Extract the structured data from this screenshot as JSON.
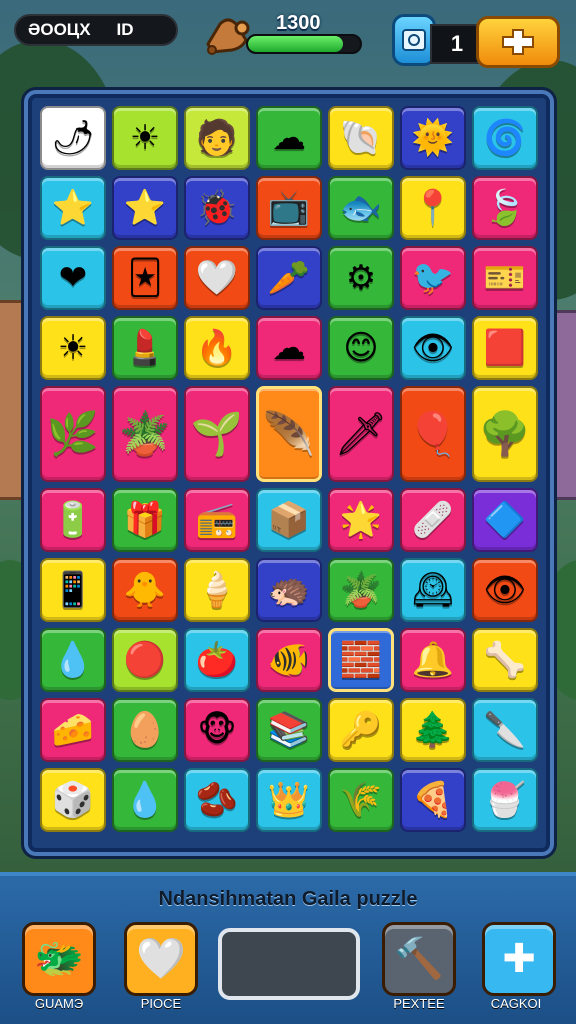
{
  "hud": {
    "score_label": "ƏOOЦX",
    "score_value": "ID",
    "target_score": "1300",
    "progress_fraction": 0.85,
    "lives": "1"
  },
  "board": {
    "rows": [
      [
        {
          "name": "red-leaf",
          "glyph": "🌶",
          "bg": "#ffffff"
        },
        {
          "name": "sun",
          "glyph": "☀",
          "bg": "#a6e22e"
        },
        {
          "name": "hat-person",
          "glyph": "🧑",
          "bg": "#c6e83a"
        },
        {
          "name": "cloud-face",
          "glyph": "☁",
          "bg": "#35b83a"
        },
        {
          "name": "fan-shell",
          "glyph": "🐚",
          "bg": "#ffe11a"
        },
        {
          "name": "sun-face",
          "glyph": "🌞",
          "bg": "#3340c8"
        },
        {
          "name": "swirl",
          "glyph": "🌀",
          "bg": "#2bc4e8"
        }
      ],
      [
        {
          "name": "star-map",
          "glyph": "⭐",
          "bg": "#2bc4e8"
        },
        {
          "name": "star-face",
          "glyph": "⭐",
          "bg": "#3340c8"
        },
        {
          "name": "purple-bug",
          "glyph": "🐞",
          "bg": "#3340c8"
        },
        {
          "name": "tv-screen",
          "glyph": "📺",
          "bg": "#f24a14"
        },
        {
          "name": "gray-fish",
          "glyph": "🐟",
          "bg": "#35b83a"
        },
        {
          "name": "pin",
          "glyph": "📍",
          "bg": "#ffe11a"
        },
        {
          "name": "red-leaf-2",
          "glyph": "🍃",
          "bg": "#f02878"
        }
      ],
      [
        {
          "name": "heart",
          "glyph": "❤",
          "bg": "#2bc4e8"
        },
        {
          "name": "card",
          "glyph": "🃏",
          "bg": "#f24a14"
        },
        {
          "name": "white-heart",
          "glyph": "🤍",
          "bg": "#f24a14"
        },
        {
          "name": "carrot",
          "glyph": "🥕",
          "bg": "#3340c8"
        },
        {
          "name": "gear-sun",
          "glyph": "⚙",
          "bg": "#35b83a"
        },
        {
          "name": "green-bird",
          "glyph": "🐦",
          "bg": "#f02878"
        },
        {
          "name": "ticket",
          "glyph": "🎫",
          "bg": "#f02878"
        }
      ],
      [
        {
          "name": "sun-2",
          "glyph": "☀",
          "bg": "#ffe11a"
        },
        {
          "name": "lipstick",
          "glyph": "💄",
          "bg": "#35b83a"
        },
        {
          "name": "flame",
          "glyph": "🔥",
          "bg": "#ffe11a"
        },
        {
          "name": "cyan-cloud",
          "glyph": "☁",
          "bg": "#f02878"
        },
        {
          "name": "smiley",
          "glyph": "😊",
          "bg": "#35b83a"
        },
        {
          "name": "eye",
          "glyph": "👁",
          "bg": "#2bc4e8"
        },
        {
          "name": "red-box",
          "glyph": "🟥",
          "bg": "#ffe11a"
        }
      ],
      [
        {
          "name": "plant",
          "glyph": "🌿",
          "bg": "#f02878",
          "tall": true
        },
        {
          "name": "potted-plant",
          "glyph": "🪴",
          "bg": "#f02878",
          "tall": true
        },
        {
          "name": "branch",
          "glyph": "🌱",
          "bg": "#f02878",
          "tall": true
        },
        {
          "name": "feather",
          "glyph": "🪶",
          "bg": "#ff8a1a",
          "tall": true,
          "sel": true
        },
        {
          "name": "sword",
          "glyph": "🗡",
          "bg": "#f02878",
          "tall": true
        },
        {
          "name": "balloon",
          "glyph": "🎈",
          "bg": "#f24a14",
          "tall": true
        },
        {
          "name": "tree",
          "glyph": "🌳",
          "bg": "#ffe11a",
          "tall": true
        }
      ],
      [
        {
          "name": "battery",
          "glyph": "🔋",
          "bg": "#f02878"
        },
        {
          "name": "chest",
          "glyph": "🎁",
          "bg": "#35b83a"
        },
        {
          "name": "radio",
          "glyph": "📻",
          "bg": "#f02878"
        },
        {
          "name": "box",
          "glyph": "📦",
          "bg": "#2bc4e8"
        },
        {
          "name": "sun-burst",
          "glyph": "🌟",
          "bg": "#f02878"
        },
        {
          "name": "bandage",
          "glyph": "🩹",
          "bg": "#f02878"
        },
        {
          "name": "dots-box",
          "glyph": "🔷",
          "bg": "#7a2ed8"
        }
      ],
      [
        {
          "name": "phone",
          "glyph": "📱",
          "bg": "#ffe11a"
        },
        {
          "name": "chick",
          "glyph": "🐥",
          "bg": "#f24a14"
        },
        {
          "name": "cream",
          "glyph": "🍦",
          "bg": "#ffe11a"
        },
        {
          "name": "spiky-ball",
          "glyph": "🦔",
          "bg": "#3340c8"
        },
        {
          "name": "bowl-plant",
          "glyph": "🪴",
          "bg": "#35b83a"
        },
        {
          "name": "clock-face",
          "glyph": "🕰",
          "bg": "#2bc4e8"
        },
        {
          "name": "spiky-eye",
          "glyph": "👁",
          "bg": "#f24a14"
        }
      ],
      [
        {
          "name": "drop-face",
          "glyph": "💧",
          "bg": "#35b83a"
        },
        {
          "name": "red-drop",
          "glyph": "🔴",
          "bg": "#a6e22e"
        },
        {
          "name": "tomato",
          "glyph": "🍅",
          "bg": "#2bc4e8"
        },
        {
          "name": "fish",
          "glyph": "🐠",
          "bg": "#f02878"
        },
        {
          "name": "crate",
          "glyph": "🧱",
          "bg": "#2f6ad8",
          "sel": true
        },
        {
          "name": "bell-face",
          "glyph": "🔔",
          "bg": "#f02878"
        },
        {
          "name": "bone",
          "glyph": "🦴",
          "bg": "#ffe11a"
        }
      ],
      [
        {
          "name": "cheese",
          "glyph": "🧀",
          "bg": "#f02878"
        },
        {
          "name": "egg",
          "glyph": "🥚",
          "bg": "#35b83a"
        },
        {
          "name": "monkey",
          "glyph": "🐵",
          "bg": "#f02878"
        },
        {
          "name": "books",
          "glyph": "📚",
          "bg": "#35b83a"
        },
        {
          "name": "key",
          "glyph": "🔑",
          "bg": "#ffe11a"
        },
        {
          "name": "bush",
          "glyph": "🌲",
          "bg": "#ffe11a"
        },
        {
          "name": "knife",
          "glyph": "🔪",
          "bg": "#2bc4e8"
        }
      ],
      [
        {
          "name": "dice",
          "glyph": "🎲",
          "bg": "#ffe11a"
        },
        {
          "name": "white-drop",
          "glyph": "💧",
          "bg": "#35b83a"
        },
        {
          "name": "bean",
          "glyph": "🫘",
          "bg": "#2bc4e8"
        },
        {
          "name": "crown-hand",
          "glyph": "👑",
          "bg": "#2bc4e8"
        },
        {
          "name": "grass",
          "glyph": "🌾",
          "bg": "#35b83a"
        },
        {
          "name": "pizza",
          "glyph": "🍕",
          "bg": "#3340c8"
        },
        {
          "name": "cone",
          "glyph": "🍧",
          "bg": "#2bc4e8"
        }
      ]
    ]
  },
  "footer": {
    "subtitle": "Ndansihmatan Gaila puzzle",
    "buttons": [
      {
        "key": "guard",
        "label": "GUAMЭ",
        "glyph": "🐲",
        "bg": "#ff8a1a"
      },
      {
        "key": "piece",
        "label": "PIOCE",
        "glyph": "🤍",
        "bg": "#ffb020"
      },
      {
        "key": "restart",
        "label": "PEXTEE",
        "glyph": "🔨",
        "bg": "#5a6470"
      },
      {
        "key": "check",
        "label": "CAGKOI",
        "glyph": "✚",
        "bg": "#38b8f0"
      }
    ]
  },
  "colors": {
    "board_bg": "#1d3f7a",
    "board_border": "#4a78b8",
    "progress_fill": "#1fa92d",
    "add_button": "#f08b0c"
  }
}
